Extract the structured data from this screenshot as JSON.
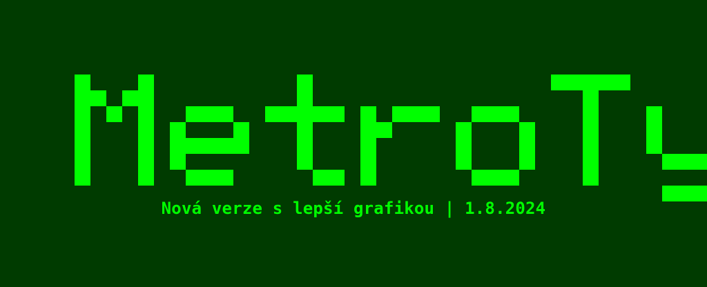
{
  "title": "MetroTyper",
  "subtitle": "Nová verze s lepší grafikou | 1.8.2024",
  "colors": {
    "background": "#003b00",
    "text": "#00ff00"
  }
}
